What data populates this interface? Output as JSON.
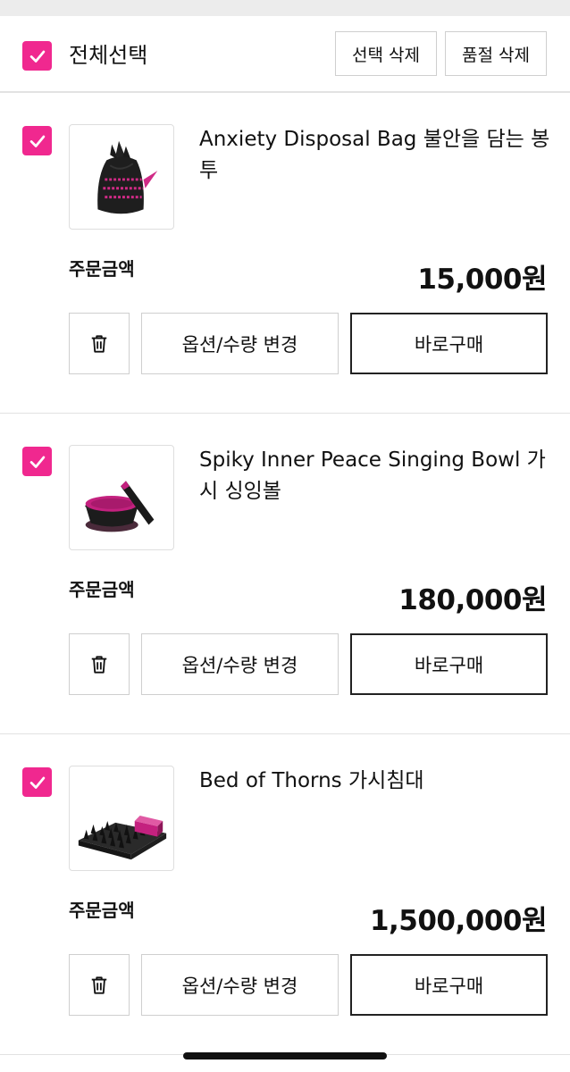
{
  "header": {
    "select_all_label": "전체선택",
    "select_all_checked": true,
    "delete_selected_label": "선택 삭제",
    "delete_soldout_label": "품절 삭제"
  },
  "items": [
    {
      "name": "Anxiety Disposal Bag 불안을 담는 봉투",
      "amount_label": "주문금액",
      "price": "15,000원",
      "checked": true,
      "option_label": "옵션/수량 변경",
      "buy_label": "바로구매"
    },
    {
      "name": "Spiky Inner Peace Singing Bowl 가시 싱잉볼",
      "amount_label": "주문금액",
      "price": "180,000원",
      "checked": true,
      "option_label": "옵션/수량 변경",
      "buy_label": "바로구매"
    },
    {
      "name": "Bed of Thorns 가시침대",
      "amount_label": "주문금액",
      "price": "1,500,000원",
      "checked": true,
      "option_label": "옵션/수량 변경",
      "buy_label": "바로구매"
    }
  ],
  "icons": {
    "checkbox": "checkmark-icon",
    "delete": "trash-icon"
  },
  "colors": {
    "accent": "#f0288f",
    "border": "#cfcfcf",
    "divider": "#e2e2e2",
    "top_bar": "#ececec",
    "text": "#111111"
  }
}
